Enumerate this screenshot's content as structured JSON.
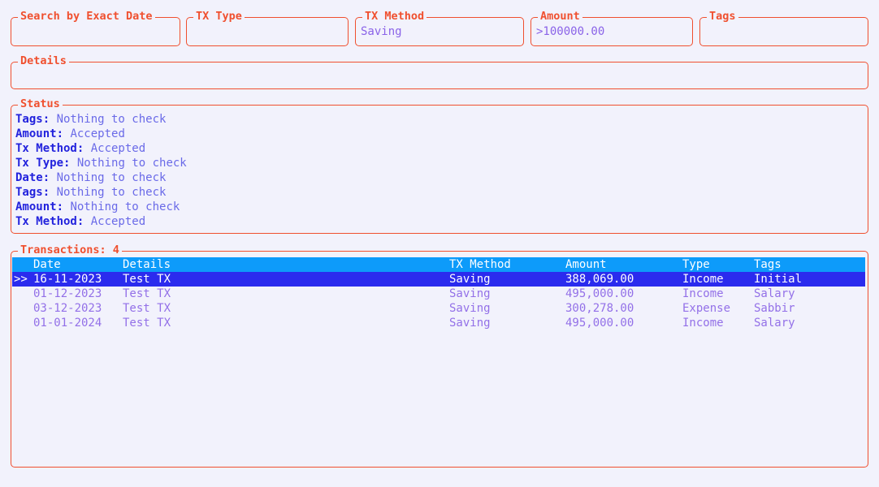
{
  "theme": {
    "background": "#f2f2fc",
    "border_accent": "#f0502f",
    "legend_color": "#f0502f",
    "input_value_color": "#8a63e8",
    "status_key_color": "#2222dd",
    "status_value_color": "#6a6ae8",
    "table_header_bg": "#0d9bfa",
    "table_selected_bg": "#2b2bee",
    "table_row_color": "#9370e8"
  },
  "filters": {
    "date": {
      "legend": "Search by Exact Date",
      "value": ""
    },
    "tx_type": {
      "legend": "TX Type",
      "value": ""
    },
    "tx_method": {
      "legend": "TX Method",
      "value": "Saving"
    },
    "amount": {
      "legend": "Amount",
      "value": ">100000.00"
    },
    "tags": {
      "legend": "Tags",
      "value": ""
    }
  },
  "details": {
    "legend": "Details",
    "value": ""
  },
  "status": {
    "legend": "Status",
    "separator": ":",
    "rows": [
      {
        "key": "Tags",
        "value": "Nothing to check"
      },
      {
        "key": "Amount",
        "value": "Accepted"
      },
      {
        "key": "Tx Method",
        "value": "Accepted"
      },
      {
        "key": "Tx Type",
        "value": "Nothing to check"
      },
      {
        "key": "Date",
        "value": "Nothing to check"
      },
      {
        "key": "Tags",
        "value": "Nothing to check"
      },
      {
        "key": "Amount",
        "value": "Nothing to check"
      },
      {
        "key": "Tx Method",
        "value": "Accepted"
      }
    ]
  },
  "transactions": {
    "legend": "Transactions: 4",
    "count": 4,
    "selected_index": 0,
    "selection_marker": ">>",
    "columns": [
      "Date",
      "Details",
      "TX Method",
      "Amount",
      "Type",
      "Tags"
    ],
    "header": {
      "marker": "",
      "date": "Date",
      "details": "Details",
      "method": "TX Method",
      "amount": "Amount",
      "type": "Type",
      "tags": "Tags"
    },
    "rows": [
      {
        "marker": ">>",
        "date": "16-11-2023",
        "details": "Test TX",
        "method": "Saving",
        "amount": "388,069.00",
        "type": "Income",
        "tags": "Initial",
        "selected": true
      },
      {
        "marker": "",
        "date": "01-12-2023",
        "details": "Test TX",
        "method": "Saving",
        "amount": "495,000.00",
        "type": "Income",
        "tags": "Salary",
        "selected": false
      },
      {
        "marker": "",
        "date": "03-12-2023",
        "details": "Test TX",
        "method": "Saving",
        "amount": "300,278.00",
        "type": "Expense",
        "tags": "Sabbir",
        "selected": false
      },
      {
        "marker": "",
        "date": "01-01-2024",
        "details": "Test TX",
        "method": "Saving",
        "amount": "495,000.00",
        "type": "Income",
        "tags": "Salary",
        "selected": false
      }
    ]
  }
}
